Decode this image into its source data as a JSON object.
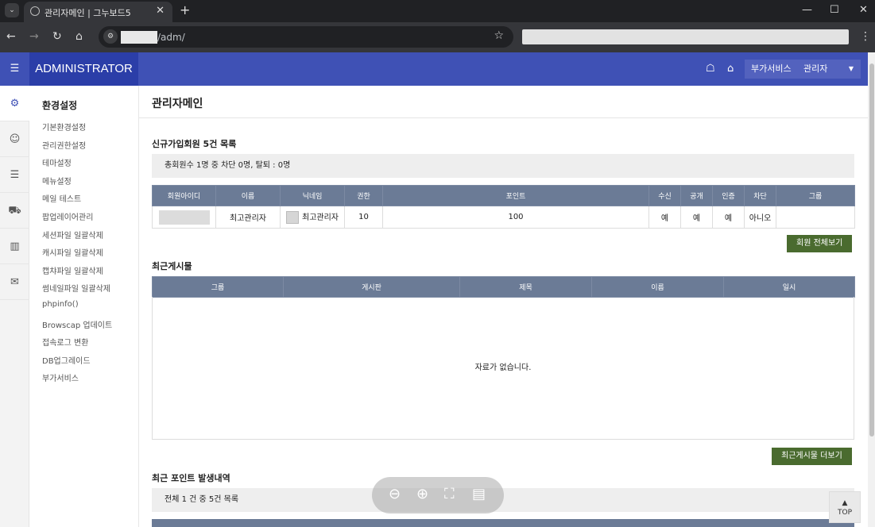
{
  "browser": {
    "tab_title": "관리자메인 | 그누보드5",
    "url_path": "/adm/",
    "glyphs": {
      "tab_menu": "⌄",
      "close": "✕",
      "new_tab": "+",
      "minimize": "—",
      "maximize": "☐",
      "win_close": "✕",
      "back": "←",
      "forward": "→",
      "reload": "↻",
      "home": "⌂",
      "site_info": "⚙",
      "star": "☆",
      "kebab": "⋮"
    }
  },
  "header": {
    "brand": "ADMINISTRATOR",
    "menu_toggle_icon": "☰",
    "glyphs": {
      "store": "☖",
      "home": "⌂",
      "dropdown": "▼"
    },
    "addon_label": "부가서비스",
    "admin_label": "관리자",
    "accent": "#3f51b5"
  },
  "iconbar": {
    "icons": [
      {
        "name": "gear-icon",
        "glyph": "⚙"
      },
      {
        "name": "user-icon",
        "glyph": "☺"
      },
      {
        "name": "list-icon",
        "glyph": "☰"
      },
      {
        "name": "cart-icon",
        "glyph": "⛟"
      },
      {
        "name": "chart-icon",
        "glyph": "▥"
      },
      {
        "name": "mail-icon",
        "glyph": "✉"
      }
    ]
  },
  "sidebar": {
    "heading": "환경설정",
    "items": [
      "기본환경설정",
      "관리권한설정",
      "테마설정",
      "메뉴설정",
      "메일 테스트",
      "팝업레이어관리",
      "세션파일 일괄삭제",
      "캐시파일 일괄삭제",
      "캡챠파일 일괄삭제",
      "썸네일파일 일괄삭제",
      "phpinfo()",
      "Browscap 업데이트",
      "접속로그 변환",
      "DB업그레이드",
      "부가서비스"
    ]
  },
  "main": {
    "title": "관리자메인",
    "new_members": {
      "title": "신규가입회원 5건 목록",
      "summary": "총회원수 1명 중 차단 0명, 탈퇴 : 0명",
      "columns": [
        "회원아이디",
        "이름",
        "닉네임",
        "권한",
        "포인트",
        "수신",
        "공개",
        "인증",
        "차단",
        "그룹"
      ],
      "rows": [
        {
          "name": "최고관리자",
          "nick": "최고관리자",
          "level": "10",
          "point": "100",
          "mailing": "예",
          "open": "예",
          "cert": "예",
          "blocked": "아니오",
          "group": ""
        }
      ],
      "button": "회원 전체보기"
    },
    "recent_posts": {
      "title": "최근게시물",
      "columns": [
        "그룹",
        "게시판",
        "제목",
        "이름",
        "일시"
      ],
      "empty": "자료가 없습니다.",
      "button": "최근게시물 더보기"
    },
    "recent_points": {
      "title": "최근 포인트 발생내역",
      "summary": "전체 1 건 중 5건 목록"
    }
  },
  "overlay": {
    "zoom_icons": [
      "⊖",
      "⊕",
      "⛶",
      "▤"
    ],
    "top_arrow": "▲",
    "top_label": "TOP"
  }
}
